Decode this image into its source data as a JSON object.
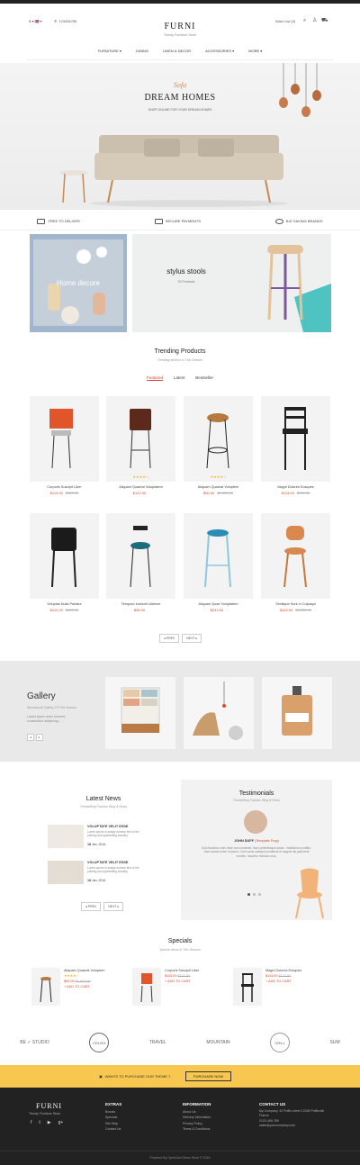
{
  "header": {
    "phone": "123456789",
    "flags": "$ ▾  🇬🇧 ▾",
    "logo": "FURNI",
    "tagline": "Trendy Furniture Store",
    "wishlist": "Wish List (0)"
  },
  "nav": {
    "items": [
      "FURNITURE",
      "DINING",
      "LINEN & DECOR",
      "ACCESSORIES",
      "MORE"
    ]
  },
  "hero": {
    "script": "Sofa",
    "title": "DREAM HOMES",
    "subtitle": "SHOP ONLINE FOR YOUR DREAM HOMES"
  },
  "features": [
    "FREE TO DELIVER",
    "SECURE PAYMENTS",
    "BIG SAVING BRANDS"
  ],
  "banners": {
    "left_title": "Home decore",
    "right_title": "stylus stools",
    "right_sub": "20 Products"
  },
  "trending": {
    "title": "Trending Products",
    "subtitle": "Trending fashion In This Season",
    "tabs": [
      "Featured",
      "Latest",
      "Bestseller"
    ],
    "products": [
      {
        "name": "Corporis Suscipit Liber",
        "price": "$114.00",
        "old": "$122.00",
        "stars": ""
      },
      {
        "name": "Aliquam Quaerat Voluptatem",
        "price": "$122.00",
        "old": "",
        "stars": "★★★★☆"
      },
      {
        "name": "Aliquam Quaerat Voluptem",
        "price": "$90.00",
        "old": "$1,002.00",
        "stars": "★★★★☆"
      },
      {
        "name": "Magni Dolores Eosques",
        "price": "$113.00",
        "old": "$122.00",
        "stars": ""
      },
      {
        "name": "Voluptas Nulla Pariatur",
        "price": "$112.00",
        "old": "$122.00",
        "stars": ""
      },
      {
        "name": "Tempora Incidunt Ulabore",
        "price": "$98.00",
        "old": "",
        "stars": ""
      },
      {
        "name": "Aliquam Quae Voluptatem",
        "price": "$242.00",
        "old": "",
        "stars": ""
      },
      {
        "name": "Similique Sunt In Culpaqui",
        "price": "$113.00",
        "old": "$1,202.00",
        "stars": ""
      }
    ],
    "prev": "◂ PREV",
    "next": "NEXT ▸"
  },
  "gallery": {
    "title": "Gallery",
    "subtitle": "Showing all Gallery Of This Season",
    "text": "Lorem ipsum dolor sit amet, consectetur adipiscing..."
  },
  "news": {
    "title": "Latest News",
    "subtitle": "Trendslifing Fashion Blog & News",
    "items": [
      {
        "title": "VOLUPTATE VELIT ESSE",
        "text": "Lorem ipsum is simply dummy text of the printing and typesetting industry",
        "date": "18",
        "month": "Jan, 2016"
      },
      {
        "title": "VOLUPTATE VELIT ESSE",
        "text": "Lorem ipsum is simply dummy text of the printing and typesetting industry",
        "date": "18",
        "month": "Jan, 2016"
      }
    ],
    "prev": "◂ PREV",
    "next": "NEXT ▸"
  },
  "testimonials": {
    "title": "Testimonials",
    "subtitle": "Trendslifing Fashion Blog & News",
    "name": "JOHN DUFF",
    "role": "(Template Frog)",
    "text": "Duis faucibus enim vitae nunc molestie. Nam pellentesque ipsum. Vestibulum porttitor. Nam lacinia lorem id ipsum. Cum sociis natoque penatibus et magnis dis parturient montes, nascetur ridiculus mus."
  },
  "specials": {
    "title": "Specials",
    "subtitle": "Special Items In This Season",
    "items": [
      {
        "name": "Aliquam Quaerat Voluptem",
        "price": "$90.00",
        "old": "$1,002.00",
        "stars": "★★★★☆"
      },
      {
        "name": "Corporis Suscipit Liber",
        "price": "$114.00",
        "old": "$122.00",
        "stars": ""
      },
      {
        "name": "Magni Dolores Eosques",
        "price": "$113.00",
        "old": "$122.00",
        "stars": ""
      }
    ],
    "add": "+ ADD TO CART"
  },
  "brands": [
    "BE ✓ STUDIO",
    "CRUSH",
    "TRAVEL",
    "MOUNTAIN",
    "GRILL",
    "SUM"
  ],
  "promo": {
    "text": "WANTS TO PURCHASE OUR THEME ?",
    "button": "PURCHASE NOW"
  },
  "footer": {
    "logo": "FURNI",
    "tagline": "Trendy Furniture Store",
    "extras_title": "EXTRAS",
    "extras": [
      "Brands",
      "Specials",
      "Site Map",
      "Contact Us"
    ],
    "info_title": "INFORMATION",
    "info": [
      "About Us",
      "Delivery Information",
      "Privacy Policy",
      "Terms & Conditions"
    ],
    "contact_title": "CONTACT US",
    "contact": [
      "My Company, 42 Puffin street 12345 Puffinville France",
      "0123-456-789",
      "sales@yourcompany.com"
    ],
    "copyright": "Powered By OpenCart Demo Store © 2016"
  },
  "colors": {
    "accent": "#d34b2b",
    "promo": "#f7c74f",
    "footer": "#222222"
  }
}
